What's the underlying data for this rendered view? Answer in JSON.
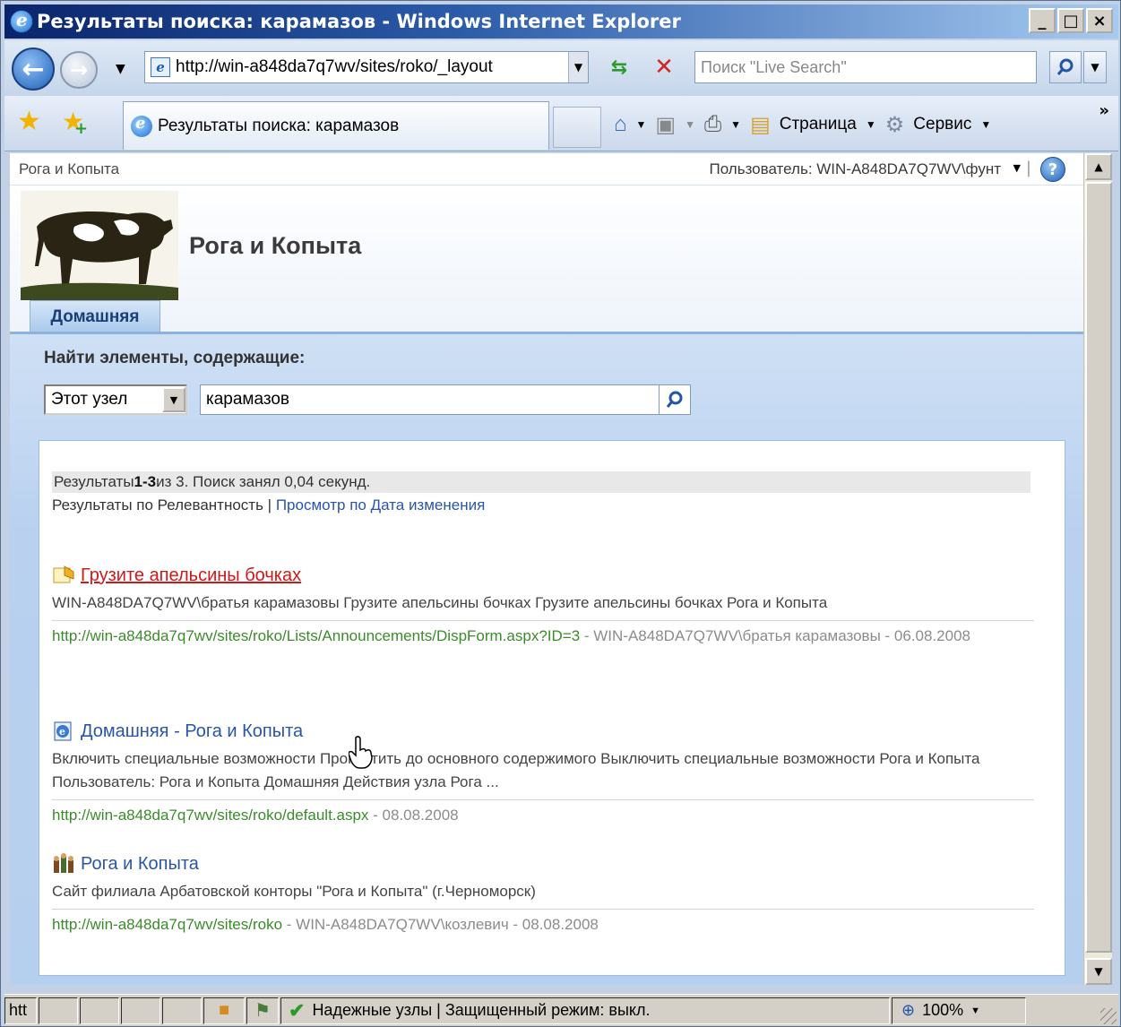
{
  "window": {
    "title": "Результаты поиска: карамазов - Windows Internet Explorer",
    "min_label": "_",
    "max_label": "□",
    "close_label": "×"
  },
  "addressbar": {
    "url": "http://win-a848da7q7wv/sites/roko/_layout",
    "search_placeholder": "Поиск \"Live Search\""
  },
  "tabs": [
    {
      "label": "Результаты поиска: карамазов"
    }
  ],
  "commandbar": {
    "page_label": "Страница",
    "tools_label": "Сервис",
    "more": "»"
  },
  "sharepoint": {
    "site_link": "Рога и Копыта",
    "user_label": "Пользователь: WIN-A848DA7Q7WV\\фунт",
    "site_title": "Рога и Копыта",
    "home_tab": "Домашняя",
    "find_label": "Найти элементы, содержащие:",
    "scope_value": "Этот узел",
    "query_value": "карамазов"
  },
  "results_header": {
    "prefix": "Результаты ",
    "range": "1-3",
    "suffix": " из 3. Поиск занял 0,04 секунд.",
    "sort_current": "Результаты по Релевантность",
    "sort_sep": " | ",
    "sort_link": "Просмотр по Дата изменения"
  },
  "results": [
    {
      "title": "Грузите апельсины бочках",
      "desc": "WIN-A848DA7Q7WV\\братья карамазовы Грузите апельсины бочках Грузите апельсины бочках Рога и Копыта",
      "url": "http://win-a848da7q7wv/sites/roko/Lists/Announcements/DispForm.aspx?ID=3",
      "meta": " - WIN-A848DA7Q7WV\\братья карамазовы - 06.08.2008",
      "icon": "announcement-icon"
    },
    {
      "title": "Домашняя - Рога и Копыта",
      "desc": "Включить специальные возможности Пропустить до основного содержимого Выключить специальные возможности Рога и Копыта Пользователь: Рога и Копыта Домашняя Действия узла Рога ...",
      "url": "http://win-a848da7q7wv/sites/roko/default.aspx",
      "meta": " - 08.08.2008",
      "icon": "web-page-icon"
    },
    {
      "title": "Рога и Копыта",
      "desc": "Сайт филиала Арбатовской конторы \"Рога и Копыта\" (г.Черноморск)",
      "url": "http://win-a848da7q7wv/sites/roko",
      "meta": " - WIN-A848DA7Q7WV\\козлевич - 08.08.2008",
      "icon": "site-icon"
    }
  ],
  "statusbar": {
    "left_text": "htt",
    "zone_text": "Надежные узлы | Защищенный режим: выкл.",
    "zoom_text": "100%"
  },
  "colors": {
    "link": "#2a55a8",
    "link_hover": "#d01818",
    "url_green": "#3a8c2a",
    "title_bar_start": "#0a246a"
  }
}
